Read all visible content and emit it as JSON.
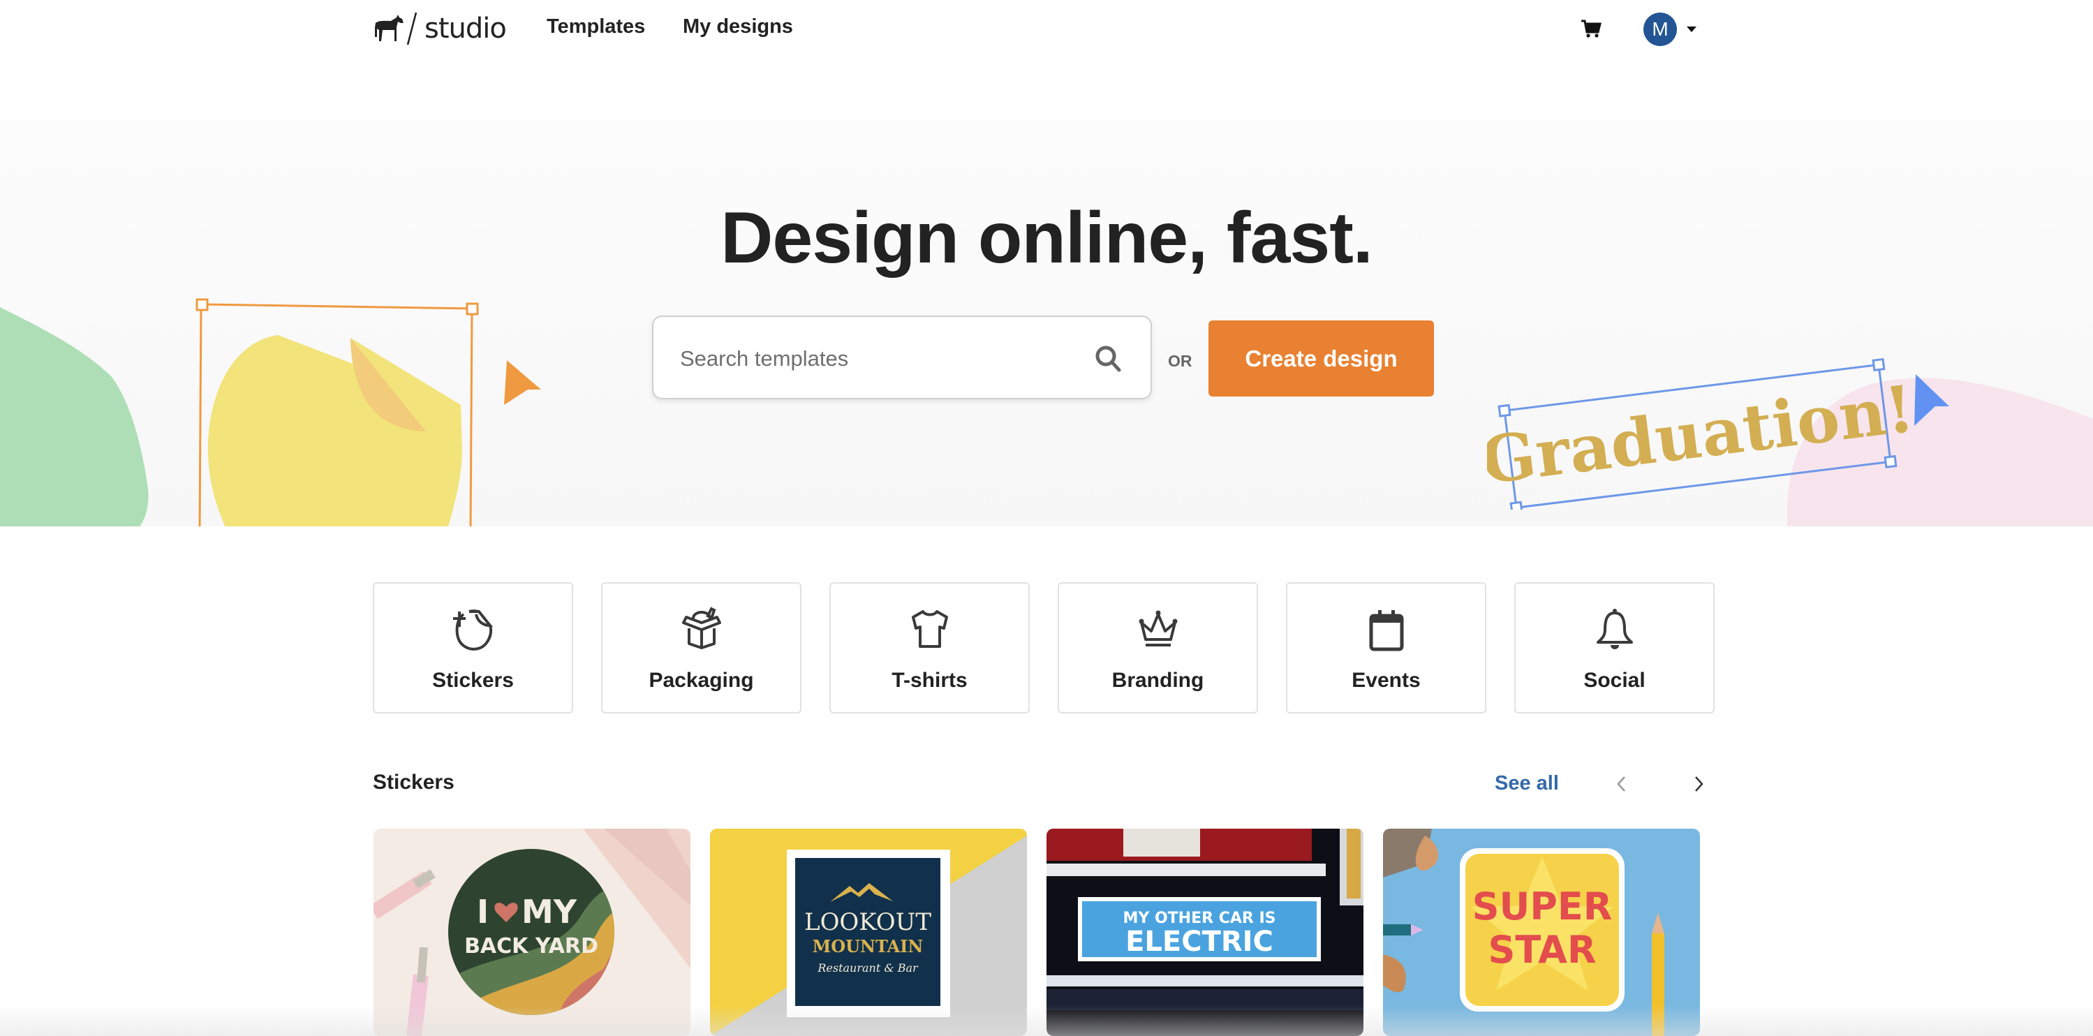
{
  "header": {
    "logo_text": "studio",
    "logo_icon": "horse-icon",
    "nav": [
      {
        "label": "Templates"
      },
      {
        "label": "My designs"
      }
    ],
    "cart_icon": "cart-icon",
    "avatar_initial": "M",
    "avatar_color": "#235594"
  },
  "hero": {
    "title": "Design online, fast.",
    "search": {
      "placeholder": "Search templates",
      "value": "",
      "icon": "search-icon"
    },
    "or_label": "OR",
    "create_button": "Create design",
    "accent_color": "#e88131",
    "decoration_text": "Graduation!"
  },
  "categories": [
    {
      "label": "Stickers",
      "icon": "sticker-icon"
    },
    {
      "label": "Packaging",
      "icon": "box-icon"
    },
    {
      "label": "T-shirts",
      "icon": "tshirt-icon"
    },
    {
      "label": "Branding",
      "icon": "crown-icon"
    },
    {
      "label": "Events",
      "icon": "calendar-icon"
    },
    {
      "label": "Social",
      "icon": "bell-icon"
    }
  ],
  "section": {
    "title": "Stickers",
    "see_all": "See all",
    "link_color": "#3469a8",
    "templates": [
      {
        "name": "I love my backyard sticker",
        "line1": "I",
        "line1b": "MY",
        "line2": "BACK YARD"
      },
      {
        "name": "Lookout Mountain sticker",
        "line1": "LOOKOUT",
        "line2": "MOUNTAIN",
        "line3": "Restaurant & Bar"
      },
      {
        "name": "Electric car bumper sticker",
        "line1": "MY OTHER CAR IS",
        "line2": "ELECTRIC"
      },
      {
        "name": "Super Star sticker",
        "line1": "SUPER",
        "line2": "STAR"
      }
    ]
  }
}
